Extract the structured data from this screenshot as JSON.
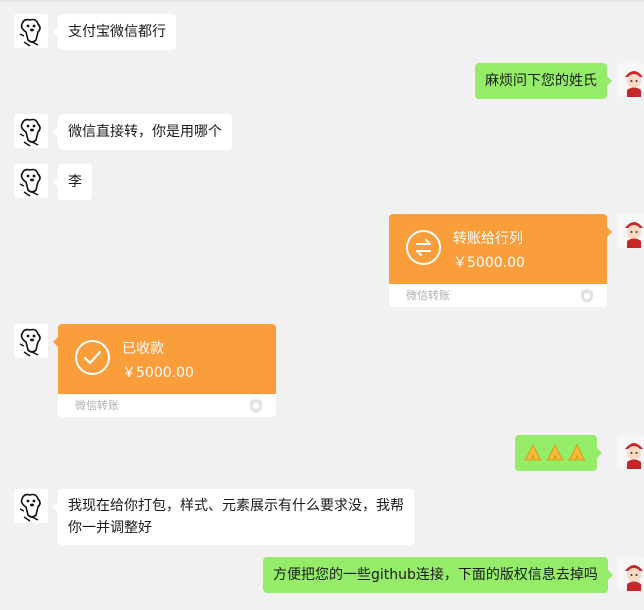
{
  "chat": {
    "messages": [
      {
        "side": "left",
        "type": "text",
        "text": "支付宝微信都行"
      },
      {
        "side": "right",
        "type": "text",
        "text": "麻烦问下您的姓氏"
      },
      {
        "side": "left",
        "type": "text",
        "text": "微信直接转，你是用哪个"
      },
      {
        "side": "left",
        "type": "text",
        "text": "李"
      },
      {
        "side": "right",
        "type": "transfer",
        "title": "转账给行列",
        "amount": "￥5000.00",
        "source": "微信转账",
        "icon": "transfer-arrows-icon"
      },
      {
        "side": "left",
        "type": "transfer",
        "title": "已收款",
        "amount": "￥5000.00",
        "source": "微信转账",
        "icon": "check-icon"
      },
      {
        "side": "right",
        "type": "emoji",
        "emoji": [
          "folded-hands-icon",
          "folded-hands-icon",
          "folded-hands-icon"
        ]
      },
      {
        "side": "left",
        "type": "text",
        "text": "我现在给你打包，样式、元素展示有什么要求没，我帮你一并调整好"
      },
      {
        "side": "right",
        "type": "text",
        "text": "方便把您的一些github连接，下面的版权信息去掉吗"
      }
    ]
  },
  "colors": {
    "background": "#f1f1f1",
    "incoming_bubble": "#ffffff",
    "outgoing_bubble": "#95ec69",
    "transfer_card": "#fa9d3b"
  }
}
